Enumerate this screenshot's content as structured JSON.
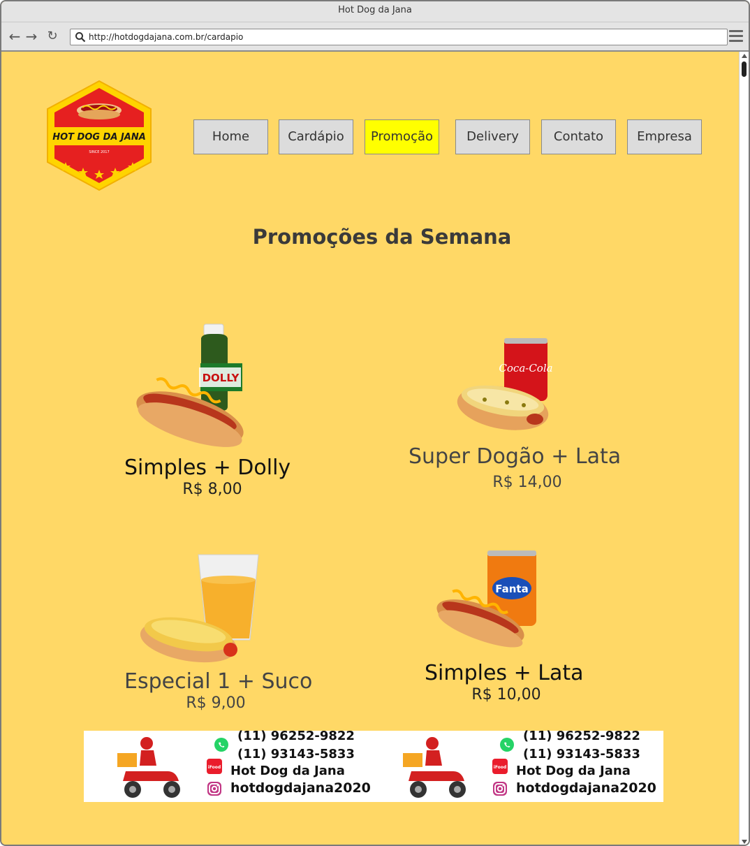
{
  "browser": {
    "window_title": "Hot Dog da Jana",
    "url": "http://hotdogdajana.com.br/cardapio"
  },
  "logo": {
    "name": "HOT DOG DA JANA",
    "since": "SINCE 2017"
  },
  "nav": {
    "items": [
      {
        "label": "Home"
      },
      {
        "label": "Cardápio"
      },
      {
        "label": "Promoção"
      },
      {
        "label": "Delivery"
      },
      {
        "label": "Contato"
      },
      {
        "label": "Empresa"
      }
    ],
    "active": "Promoção"
  },
  "page_title": "Promoções da Semana",
  "promos": [
    {
      "name": "Simples + Dolly",
      "price": "R$ 8,00",
      "drink_label": "DOLLY"
    },
    {
      "name": "Super Dogão + Lata",
      "price": "R$ 14,00",
      "drink_label": "Coca-Cola"
    },
    {
      "name": "Especial 1 + Suco",
      "price": "R$ 9,00"
    },
    {
      "name": "Simples + Lata",
      "price": "R$ 10,00",
      "drink_label": "Fanta"
    }
  ],
  "contact_banner": {
    "whatsapp": "(11) 96252-9822",
    "phone": "(11) 93143-5833",
    "ifood": "Hot Dog da Jana",
    "instagram": "hotdogdajana2020",
    "ifood_icon_text": "iFood"
  },
  "colors": {
    "page_bg": "#ffd866",
    "active_nav": "#ffff00",
    "nav_bg": "#dcdcdc"
  }
}
